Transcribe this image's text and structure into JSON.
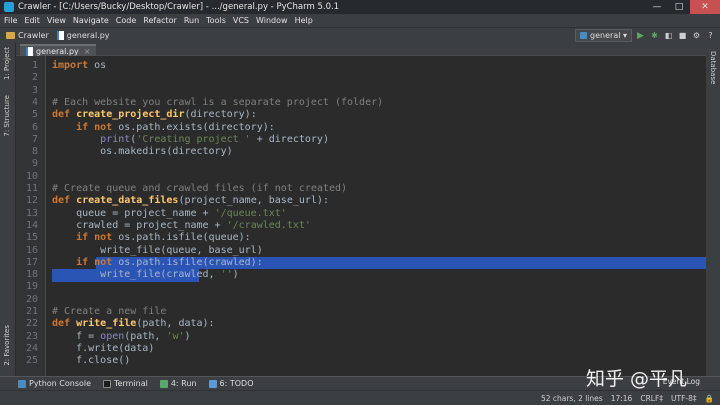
{
  "window": {
    "title": "Crawler - [C:/Users/Bucky/Desktop/Crawler] - .../general.py - PyCharm 5.0.1",
    "minimize": "—",
    "maximize": "□",
    "close": "✕"
  },
  "menu": [
    "File",
    "Edit",
    "View",
    "Navigate",
    "Code",
    "Refactor",
    "Run",
    "Tools",
    "VCS",
    "Window",
    "Help"
  ],
  "breadcrumb": {
    "project": "Crawler",
    "file": "general.py"
  },
  "toolbar": {
    "run_config": "general ▾"
  },
  "left_tools": {
    "project": "1: Project",
    "structure": "7: Structure",
    "favorites": "2: Favorites"
  },
  "right_tools": {
    "database": "Database"
  },
  "editor_tab": {
    "label": "general.py",
    "close": "×"
  },
  "code_lines": [
    {
      "n": "1"
    },
    {
      "n": "2"
    },
    {
      "n": "3"
    },
    {
      "n": "4"
    },
    {
      "n": "5"
    },
    {
      "n": "6"
    },
    {
      "n": "7"
    },
    {
      "n": "8"
    },
    {
      "n": "9"
    },
    {
      "n": "10"
    },
    {
      "n": "11"
    },
    {
      "n": "12"
    },
    {
      "n": "13"
    },
    {
      "n": "14"
    },
    {
      "n": "15"
    },
    {
      "n": "16"
    },
    {
      "n": "17"
    },
    {
      "n": "18"
    },
    {
      "n": "19"
    },
    {
      "n": "20"
    },
    {
      "n": "21"
    },
    {
      "n": "22"
    },
    {
      "n": "23"
    },
    {
      "n": "24"
    },
    {
      "n": "25"
    }
  ],
  "code": {
    "l1_kw": "import",
    "l1_rest": " os",
    "l4": "# Each website you crawl is a separate project (folder)",
    "l5_kw": "def ",
    "l5_fn": "create_project_dir",
    "l5_rest": "(directory):",
    "l6_kw": "    if not ",
    "l6_rest": "os.path.exists(directory):",
    "l7_bi": "        print",
    "l7_a": "(",
    "l7_str": "'Creating project '",
    "l7_rest": " + directory)",
    "l8": "        os.makedirs(directory)",
    "l11": "# Create queue and crawled files (if not created)",
    "l12_kw": "def ",
    "l12_fn": "create_data_files",
    "l12_rest": "(project_name, base_url):",
    "l13_a": "    queue = project_name + ",
    "l13_str": "'/queue.txt'",
    "l14_a": "    crawled = project_name + ",
    "l14_str": "'/crawled.txt'",
    "l15_kw": "    if not ",
    "l15_rest": "os.path.isfile(queue):",
    "l16": "        write_file(queue, base_url)",
    "l17_kw": "    if not ",
    "l17_rest": "os.",
    "l17_sel": "path.isfile(crawled):",
    "l18_a": "        write_file(crawled, ",
    "l18_str": "''",
    "l18_b": ")",
    "l21": "# Create a new file",
    "l22_kw": "def ",
    "l22_fn": "write_file",
    "l22_rest": "(path, data):",
    "l23_a": "    f = ",
    "l23_bi": "open",
    "l23_b": "(path, ",
    "l23_str": "'w'",
    "l23_c": ")",
    "l24": "    f.write(data)",
    "l25": "    f.close()"
  },
  "bottom_tools": {
    "python_console": "Python Console",
    "terminal": "Terminal",
    "run": "4: Run",
    "todo": "6: TODO",
    "event_log": "Event Log"
  },
  "status": {
    "selection": "52 chars, 2 lines",
    "position": "17:16",
    "line_sep": "CRLF‡",
    "encoding": "UTF-8‡"
  },
  "watermark": "知乎 @平凡",
  "colors": {
    "selection": "#214283",
    "keyword": "#cc7832",
    "function": "#ffc66d",
    "string": "#6a8759",
    "comment": "#808080"
  }
}
